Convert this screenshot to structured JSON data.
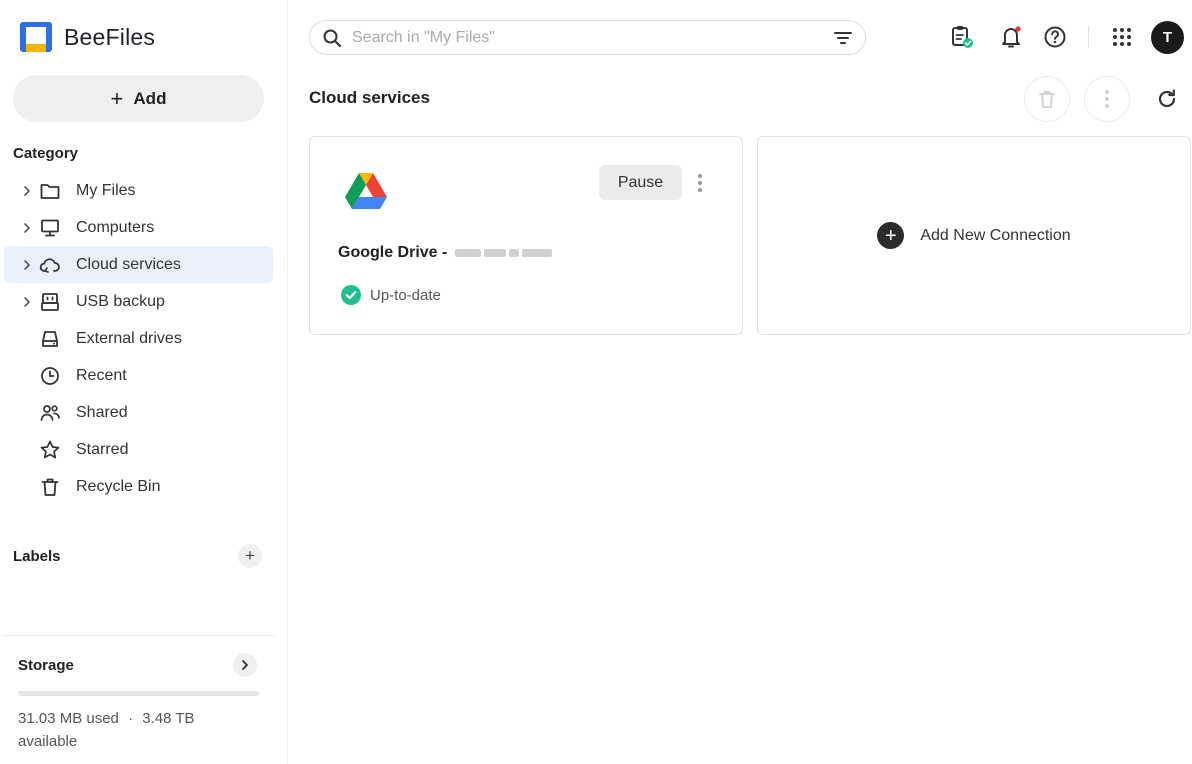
{
  "app": {
    "name": "BeeFiles"
  },
  "sidebar": {
    "add_label": "Add",
    "category_title": "Category",
    "items": [
      {
        "label": "My Files",
        "icon": "folder-icon",
        "expandable": true,
        "active": false
      },
      {
        "label": "Computers",
        "icon": "monitor-icon",
        "expandable": true,
        "active": false
      },
      {
        "label": "Cloud services",
        "icon": "cloud-sync-icon",
        "expandable": true,
        "active": true
      },
      {
        "label": "USB backup",
        "icon": "usb-icon",
        "expandable": true,
        "active": false
      },
      {
        "label": "External drives",
        "icon": "drive-icon",
        "expandable": false,
        "active": false
      },
      {
        "label": "Recent",
        "icon": "clock-icon",
        "expandable": false,
        "active": false
      },
      {
        "label": "Shared",
        "icon": "people-icon",
        "expandable": false,
        "active": false
      },
      {
        "label": "Starred",
        "icon": "star-icon",
        "expandable": false,
        "active": false
      },
      {
        "label": "Recycle Bin",
        "icon": "trash-icon",
        "expandable": false,
        "active": false
      }
    ],
    "labels_title": "Labels",
    "storage": {
      "title": "Storage",
      "used": "31.03 MB used",
      "separator": "·",
      "available": "3.48 TB available",
      "used_fraction": 0.0
    }
  },
  "header": {
    "search_placeholder": "Search in \"My Files\"",
    "avatar_initial": "T",
    "icons": [
      "task-clipboard-icon",
      "bell-icon",
      "help-icon",
      "apps-grid-icon"
    ]
  },
  "main": {
    "title": "Cloud services",
    "cards": [
      {
        "service": "Google Drive",
        "name_prefix": "Google Drive -",
        "pause_label": "Pause",
        "status": "Up-to-date"
      }
    ],
    "add_connection_label": "Add New Connection"
  },
  "colors": {
    "accent": "#3b82f6",
    "active_bg": "#e8f0fb",
    "status_ok": "#1fbf8f",
    "notify_dot": "#e53935"
  }
}
